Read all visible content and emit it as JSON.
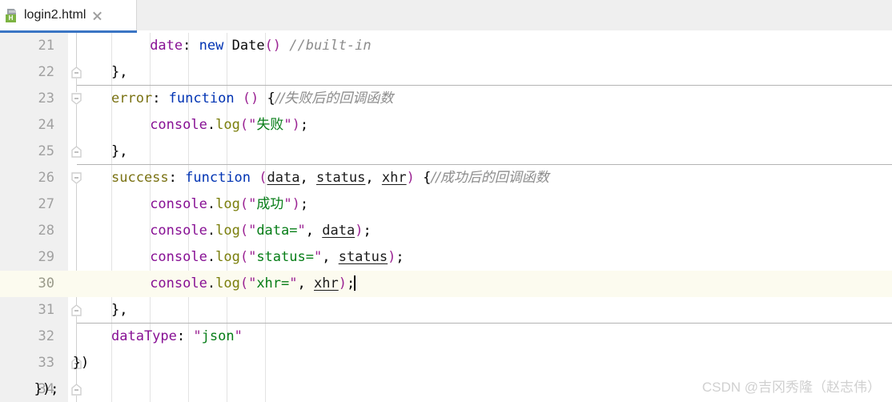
{
  "window": {
    "title": "login2.html"
  },
  "tab": {
    "label": "login2.html",
    "icon": "html-file-icon",
    "badge_letter": "H",
    "close_label": "×",
    "active": true,
    "accent_color": "#3a75c4"
  },
  "watermark": {
    "text": "CSDN @吉冈秀隆（赵志伟）"
  },
  "editor": {
    "first_line": 21,
    "last_line": 34,
    "current_line": 30,
    "line_height": 33,
    "indent_guides_x": [
      139,
      187,
      235,
      283,
      331
    ],
    "colors": {
      "background": "#ffffff",
      "gutter": "#f0f0f0",
      "current_line": "#fcfbef",
      "line_number": "#a0a0a0",
      "property": "#871094",
      "keyword": "#0033b3",
      "string": "#067d17",
      "comment": "#8c8c8c",
      "label": "#7a7213",
      "paren": "#9b2393",
      "fold_line": "#b4b4b4",
      "indent_guide": "#e3e3e3"
    },
    "lines": [
      {
        "num": 21,
        "fold": "none",
        "sep_below": false,
        "indent": 20,
        "tokens": [
          {
            "t": "date",
            "c": "t-prop"
          },
          {
            "t": ":",
            "c": "t-punct"
          },
          {
            "t": " ",
            "c": "t-punct"
          },
          {
            "t": "new",
            "c": "t-key"
          },
          {
            "t": " ",
            "c": "t-punct"
          },
          {
            "t": "Date",
            "c": "t-ident"
          },
          {
            "t": "()",
            "c": "t-paren"
          },
          {
            "t": " ",
            "c": "t-punct"
          },
          {
            "t": "//built-in",
            "c": "t-comment"
          }
        ]
      },
      {
        "num": 22,
        "fold": "end",
        "sep_below": true,
        "indent": 16,
        "tokens": [
          {
            "t": "},",
            "c": "t-punct"
          }
        ]
      },
      {
        "num": 23,
        "fold": "start",
        "sep_below": false,
        "indent": 16,
        "tokens": [
          {
            "t": "error",
            "c": "t-label"
          },
          {
            "t": ": ",
            "c": "t-punct"
          },
          {
            "t": "function",
            "c": "t-key"
          },
          {
            "t": " ",
            "c": "t-punct"
          },
          {
            "t": "()",
            "c": "t-paren"
          },
          {
            "t": " ",
            "c": "t-punct"
          },
          {
            "t": "{",
            "c": "t-punct"
          },
          {
            "t": "//失败后的回调函数",
            "c": "t-comment t-cjk"
          }
        ]
      },
      {
        "num": 24,
        "fold": "none",
        "sep_below": false,
        "indent": 20,
        "tokens": [
          {
            "t": "console",
            "c": "t-prop"
          },
          {
            "t": ".",
            "c": "t-punct"
          },
          {
            "t": "log",
            "c": "t-func"
          },
          {
            "t": "(",
            "c": "t-paren"
          },
          {
            "t": "\"",
            "c": "t-quote"
          },
          {
            "t": "失败",
            "c": "t-str t-cjk"
          },
          {
            "t": "\"",
            "c": "t-quote"
          },
          {
            "t": ")",
            "c": "t-paren"
          },
          {
            "t": ";",
            "c": "t-punct"
          }
        ]
      },
      {
        "num": 25,
        "fold": "end",
        "sep_below": true,
        "indent": 16,
        "tokens": [
          {
            "t": "},",
            "c": "t-punct"
          }
        ]
      },
      {
        "num": 26,
        "fold": "start",
        "sep_below": false,
        "indent": 16,
        "tokens": [
          {
            "t": "success",
            "c": "t-label"
          },
          {
            "t": ": ",
            "c": "t-punct"
          },
          {
            "t": "function",
            "c": "t-key"
          },
          {
            "t": " ",
            "c": "t-punct"
          },
          {
            "t": "(",
            "c": "t-paren"
          },
          {
            "t": "data",
            "c": "t-param"
          },
          {
            "t": ", ",
            "c": "t-punct"
          },
          {
            "t": "status",
            "c": "t-param"
          },
          {
            "t": ", ",
            "c": "t-punct"
          },
          {
            "t": "xhr",
            "c": "t-param"
          },
          {
            "t": ")",
            "c": "t-paren"
          },
          {
            "t": " ",
            "c": "t-punct"
          },
          {
            "t": "{",
            "c": "t-punct"
          },
          {
            "t": "//成功后的回调函数",
            "c": "t-comment t-cjk"
          }
        ]
      },
      {
        "num": 27,
        "fold": "none",
        "sep_below": false,
        "indent": 20,
        "tokens": [
          {
            "t": "console",
            "c": "t-prop"
          },
          {
            "t": ".",
            "c": "t-punct"
          },
          {
            "t": "log",
            "c": "t-func"
          },
          {
            "t": "(",
            "c": "t-paren"
          },
          {
            "t": "\"",
            "c": "t-quote"
          },
          {
            "t": "成功",
            "c": "t-str t-cjk"
          },
          {
            "t": "\"",
            "c": "t-quote"
          },
          {
            "t": ")",
            "c": "t-paren"
          },
          {
            "t": ";",
            "c": "t-punct"
          }
        ]
      },
      {
        "num": 28,
        "fold": "none",
        "sep_below": false,
        "indent": 20,
        "tokens": [
          {
            "t": "console",
            "c": "t-prop"
          },
          {
            "t": ".",
            "c": "t-punct"
          },
          {
            "t": "log",
            "c": "t-func"
          },
          {
            "t": "(",
            "c": "t-paren"
          },
          {
            "t": "\"",
            "c": "t-quote"
          },
          {
            "t": "data=",
            "c": "t-str"
          },
          {
            "t": "\"",
            "c": "t-quote"
          },
          {
            "t": ", ",
            "c": "t-punct"
          },
          {
            "t": "data",
            "c": "t-param"
          },
          {
            "t": ")",
            "c": "t-paren"
          },
          {
            "t": ";",
            "c": "t-punct"
          }
        ]
      },
      {
        "num": 29,
        "fold": "none",
        "sep_below": false,
        "indent": 20,
        "tokens": [
          {
            "t": "console",
            "c": "t-prop"
          },
          {
            "t": ".",
            "c": "t-punct"
          },
          {
            "t": "log",
            "c": "t-func"
          },
          {
            "t": "(",
            "c": "t-paren"
          },
          {
            "t": "\"",
            "c": "t-quote"
          },
          {
            "t": "status=",
            "c": "t-str"
          },
          {
            "t": "\"",
            "c": "t-quote"
          },
          {
            "t": ", ",
            "c": "t-punct"
          },
          {
            "t": "status",
            "c": "t-param"
          },
          {
            "t": ")",
            "c": "t-paren"
          },
          {
            "t": ";",
            "c": "t-punct"
          }
        ]
      },
      {
        "num": 30,
        "fold": "none",
        "sep_below": false,
        "current": true,
        "caret": true,
        "indent": 20,
        "tokens": [
          {
            "t": "console",
            "c": "t-prop"
          },
          {
            "t": ".",
            "c": "t-punct"
          },
          {
            "t": "log",
            "c": "t-func"
          },
          {
            "t": "(",
            "c": "t-paren"
          },
          {
            "t": "\"",
            "c": "t-quote"
          },
          {
            "t": "xhr=",
            "c": "t-str"
          },
          {
            "t": "\"",
            "c": "t-quote"
          },
          {
            "t": ", ",
            "c": "t-punct"
          },
          {
            "t": "xhr",
            "c": "t-param"
          },
          {
            "t": ")",
            "c": "t-paren"
          },
          {
            "t": ";",
            "c": "t-punct"
          }
        ]
      },
      {
        "num": 31,
        "fold": "end",
        "sep_below": true,
        "indent": 16,
        "tokens": [
          {
            "t": "},",
            "c": "t-punct"
          }
        ]
      },
      {
        "num": 32,
        "fold": "none",
        "sep_below": false,
        "indent": 16,
        "tokens": [
          {
            "t": "dataType",
            "c": "t-prop"
          },
          {
            "t": ": ",
            "c": "t-punct"
          },
          {
            "t": "\"",
            "c": "t-quote"
          },
          {
            "t": "json",
            "c": "t-str"
          },
          {
            "t": "\"",
            "c": "t-quote"
          }
        ]
      },
      {
        "num": 33,
        "fold": "end",
        "sep_below": false,
        "indent": 12,
        "tokens": [
          {
            "t": "})",
            "c": "t-punct"
          }
        ]
      },
      {
        "num": 34,
        "fold": "end",
        "sep_below": false,
        "indent": 8,
        "tokens": [
          {
            "t": "});",
            "c": "t-punct"
          }
        ]
      }
    ]
  }
}
